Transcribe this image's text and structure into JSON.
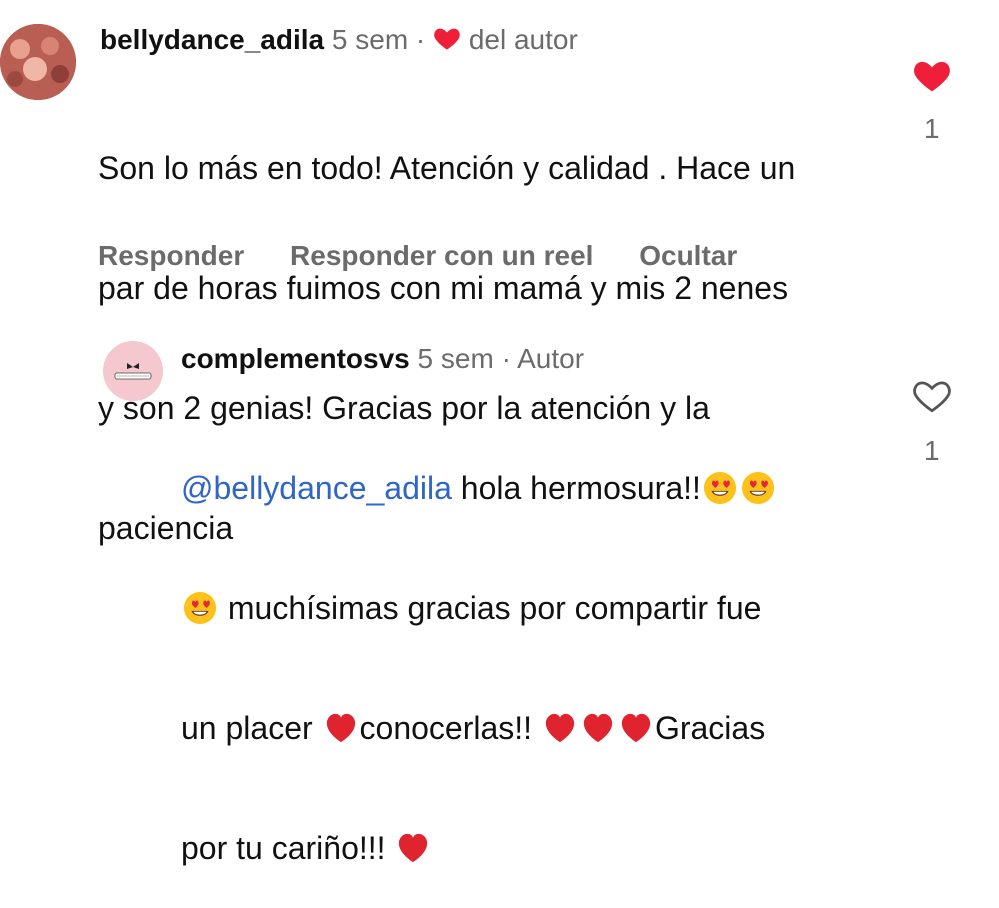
{
  "comment1": {
    "username": "bellydance_adila",
    "time": "5 sem",
    "separator": "·",
    "liked_by": "del autor",
    "line1": "Son lo más en todo! Atención y calidad . Hace un",
    "line2": "par de horas fuimos con mi mamá y mis 2 nenes",
    "line3": "y son 2 genias! Gracias por la atención y la",
    "line4": "paciencia",
    "likes": "1",
    "liked": true,
    "actions": {
      "reply": "Responder",
      "reply_reel": "Responder con un reel",
      "hide": "Ocultar"
    }
  },
  "comment2": {
    "username": "complementosvs",
    "time": "5 sem",
    "separator": "·",
    "author_label": "Autor",
    "mention": "@bellydance_adila",
    "text_a": " hola hermosura!!",
    "text_b": " muchísimas gracias por compartir fue",
    "text_c": "un placer ",
    "text_d": "conocerlas!! ",
    "text_e": "Gracias",
    "text_f": "por tu cariño!!! ",
    "likes": "1",
    "liked": false
  },
  "colors": {
    "like_red": "#ef1f3a",
    "mention_blue": "#2f64c8",
    "muted": "#6b6b6b"
  },
  "icons": {
    "heart_filled": "heart-filled-icon",
    "heart_outline": "heart-outline-icon",
    "emoji_heart_eyes": "heart-eyes-emoji",
    "emoji_red_heart": "red-heart-emoji"
  }
}
